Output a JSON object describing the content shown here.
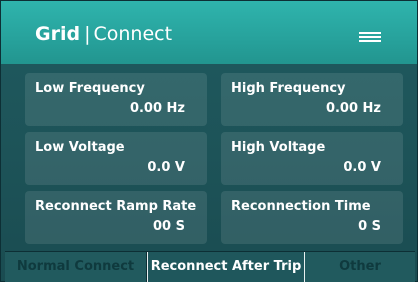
{
  "header": {
    "title_bold": "Grid",
    "title_separator": "|",
    "title_light": "Connect"
  },
  "menu": {
    "icon": "hamburger-menu-icon"
  },
  "settings": [
    {
      "label": "Low Frequency",
      "value": "0.00 Hz"
    },
    {
      "label": "High Frequency",
      "value": "0.00 Hz"
    },
    {
      "label": "Low Voltage",
      "value": "0.0 V"
    },
    {
      "label": "High Voltage",
      "value": "0.0 V"
    },
    {
      "label": "Reconnect Ramp Rate",
      "value": "00 S"
    },
    {
      "label": "Reconnection Time",
      "value": "0 S"
    }
  ],
  "tabs": [
    {
      "label": "Normal Connect"
    },
    {
      "label": "Reconnect After Trip"
    },
    {
      "label": "Other"
    }
  ],
  "colors": {
    "header": "#2fb4ad",
    "background": "#1d5358",
    "active_tab_text": "#ffffff",
    "inactive_tab_text": "#0f3a3e"
  }
}
